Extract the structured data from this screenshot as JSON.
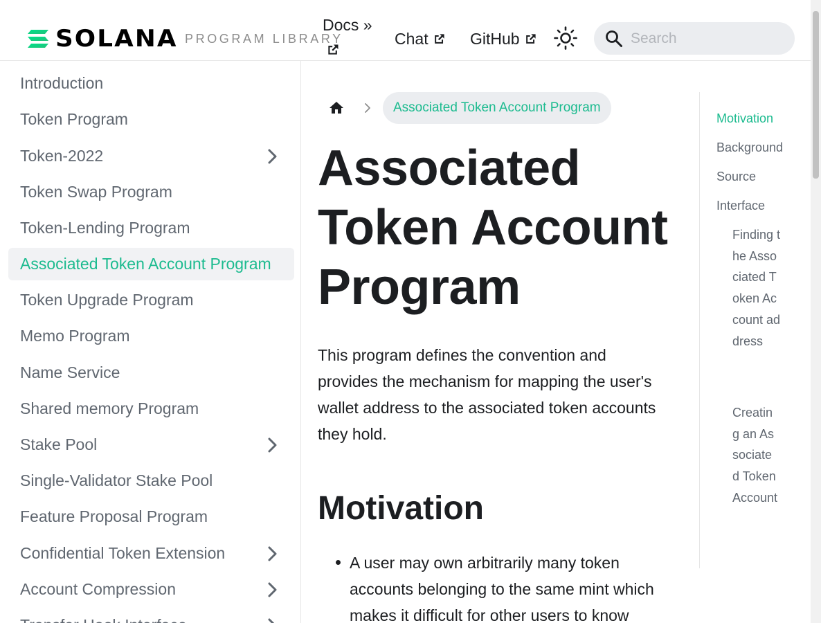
{
  "header": {
    "logo_text": "SOLANA",
    "subtitle": "PROGRAM LIBRARY",
    "docs_label": "Docs »",
    "chat_label": "Chat",
    "github_label": "GitHub",
    "search_placeholder": "Search",
    "search_value": ""
  },
  "sidebar": {
    "items": [
      {
        "label": "Introduction",
        "expandable": false,
        "active": false
      },
      {
        "label": "Token Program",
        "expandable": false,
        "active": false
      },
      {
        "label": "Token-2022",
        "expandable": true,
        "active": false
      },
      {
        "label": "Token Swap Program",
        "expandable": false,
        "active": false
      },
      {
        "label": "Token-Lending Program",
        "expandable": false,
        "active": false
      },
      {
        "label": "Associated Token Account Program",
        "expandable": false,
        "active": true
      },
      {
        "label": "Token Upgrade Program",
        "expandable": false,
        "active": false
      },
      {
        "label": "Memo Program",
        "expandable": false,
        "active": false
      },
      {
        "label": "Name Service",
        "expandable": false,
        "active": false
      },
      {
        "label": "Shared memory Program",
        "expandable": false,
        "active": false
      },
      {
        "label": "Stake Pool",
        "expandable": true,
        "active": false
      },
      {
        "label": "Single-Validator Stake Pool",
        "expandable": false,
        "active": false
      },
      {
        "label": "Feature Proposal Program",
        "expandable": false,
        "active": false
      },
      {
        "label": "Confidential Token Extension",
        "expandable": true,
        "active": false
      },
      {
        "label": "Account Compression",
        "expandable": true,
        "active": false
      },
      {
        "label": "Transfer Hook Interface",
        "expandable": true,
        "active": false
      }
    ]
  },
  "breadcrumb": {
    "current": "Associated Token Account Program"
  },
  "main": {
    "title": "Associated Token Account Program",
    "intro": "This program defines the convention and provides the mechanism for mapping the user's wallet address to the associated token accounts they hold.",
    "motivation_heading": "Motivation",
    "bullets": [
      "A user may own arbitrarily many token accounts belonging to the same mint which makes it difficult for other users to know"
    ]
  },
  "toc": {
    "items": [
      "Motivation",
      "Background",
      "Source",
      "Interface"
    ],
    "sub_items": [
      "Finding the Associated Token Account address",
      "Creating an Associated Token Account"
    ]
  },
  "colors": {
    "accent": "#1cbb8f",
    "text": "#1c1e21",
    "muted": "#606770",
    "search_bg": "#ebedf0"
  }
}
